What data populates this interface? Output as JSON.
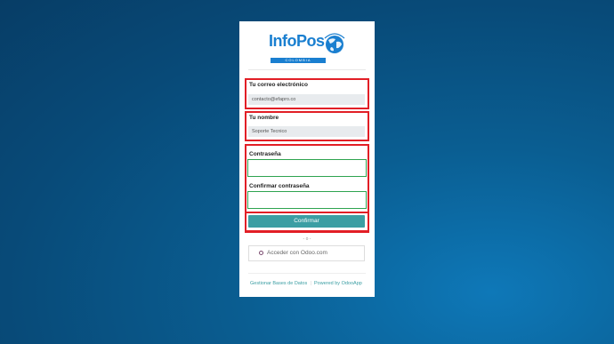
{
  "brand": {
    "logo_text": "InfoPos",
    "logo_subtext": "COLOMBIA",
    "color": "#1a7fd0"
  },
  "form": {
    "email_label": "Tu correo electrónico",
    "email_value": "contacto@efapro.co",
    "name_label": "Tu nombre",
    "name_value": "Soporte Tecnico",
    "password_label": "Contraseña",
    "password_value": "",
    "confirm_password_label": "Confirmar contraseña",
    "confirm_password_value": "",
    "submit_label": "Confirmar",
    "submit_color": "#3b9ea3"
  },
  "alt_login": {
    "separator": "- o -",
    "oauth_label": "Acceder con Odoo.com"
  },
  "footer": {
    "manage_db_link": "Gestionar Bases de Datos",
    "powered_by_link": "Powered by OdooApp"
  },
  "annotations": {
    "highlight_red": "#e21e26",
    "highlight_green": "#2ea44f"
  }
}
